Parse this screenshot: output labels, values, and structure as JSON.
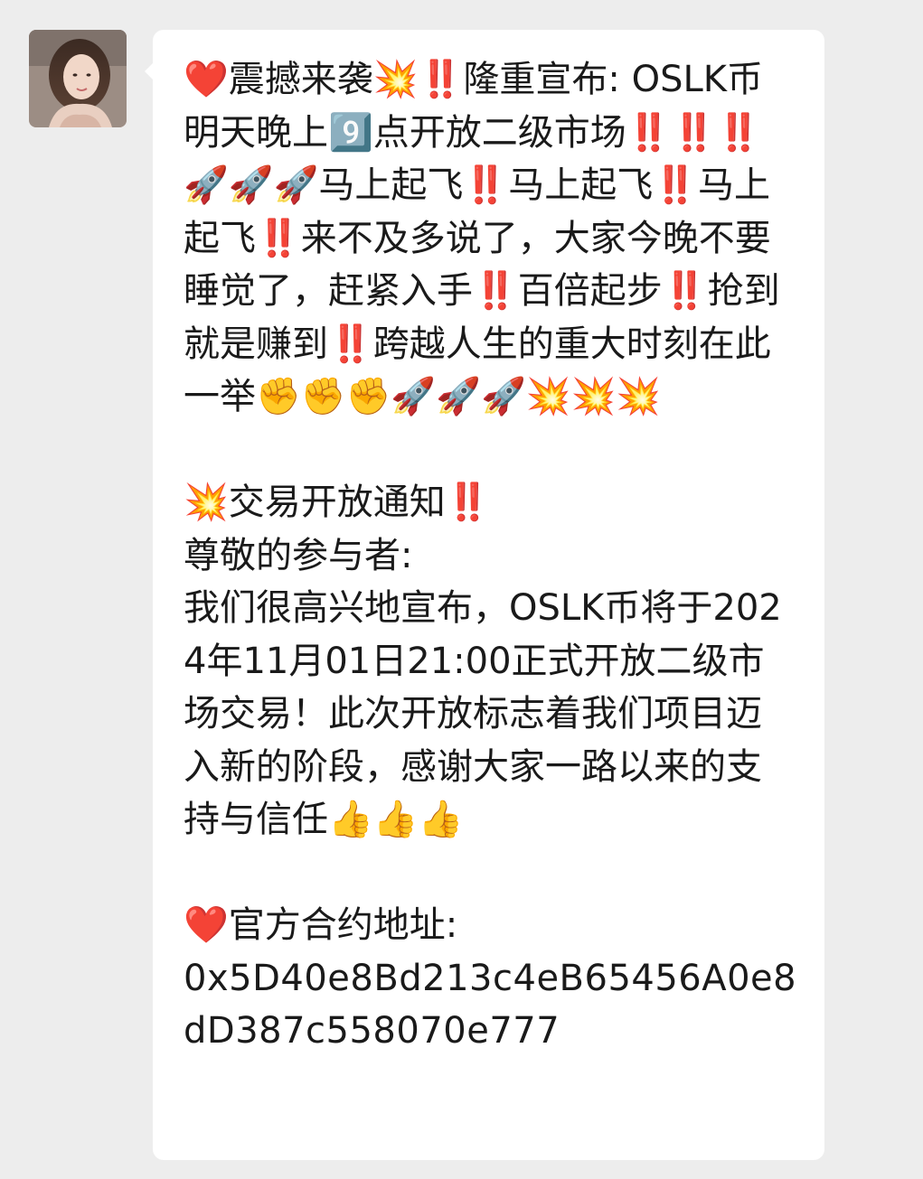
{
  "chat": {
    "sender_avatar_icon": "user-avatar-photo",
    "message": {
      "announcement": "❤️震撼来袭💥‼️隆重宣布: OSLK币明天晚上9️⃣点开放二级市场‼️‼️‼️🚀🚀🚀马上起飞‼️马上起飞‼️马上起飞‼️来不及多说了，大家今晚不要睡觉了，赶紧入手‼️百倍起步‼️抢到就是赚到‼️跨越人生的重大时刻在此一举✊✊✊🚀🚀🚀💥💥💥",
      "notice_title": "💥交易开放通知‼️",
      "notice_greeting": "尊敬的参与者:",
      "notice_body": "我们很高兴地宣布，OSLK币将于2024年11月01日21:00正式开放二级市场交易！此次开放标志着我们项目迈入新的阶段，感谢大家一路以来的支持与信任👍👍👍",
      "contract_label": "❤️官方合约地址:",
      "contract_address": "0x5D40e8Bd213c4eB65456A0e8dD387c558070e777"
    }
  },
  "colors": {
    "background": "#ededed",
    "bubble": "#ffffff",
    "text": "#1a1a1a"
  }
}
